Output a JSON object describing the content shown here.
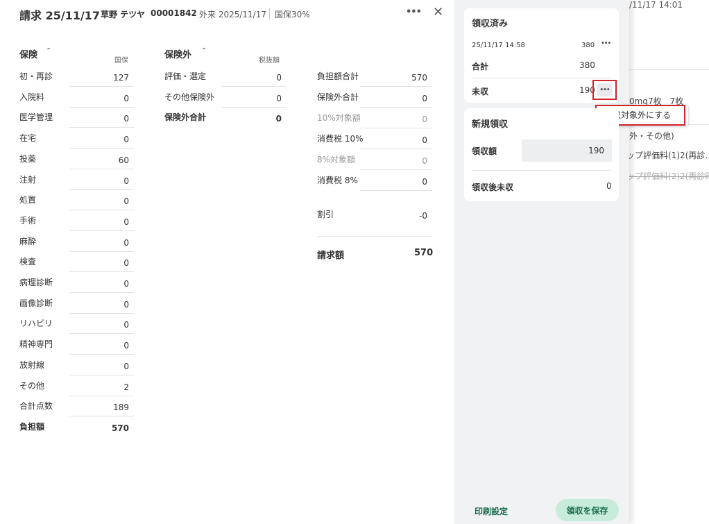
{
  "header": {
    "title": "請求 25/11/17",
    "patient_name": "草野 テツヤ",
    "patient_id": "00001842",
    "visit": "外来 2025/11/17",
    "insurance": "国保30%",
    "more_label": "•••",
    "close_label": "✕"
  },
  "insurance_section": {
    "title": "保険",
    "column_label": "国保",
    "rows": [
      {
        "label": "初・再診",
        "value": "127"
      },
      {
        "label": "入院料",
        "value": "0"
      },
      {
        "label": "医学管理",
        "value": "0"
      },
      {
        "label": "在宅",
        "value": "0"
      },
      {
        "label": "投薬",
        "value": "60"
      },
      {
        "label": "注射",
        "value": "0"
      },
      {
        "label": "処置",
        "value": "0"
      },
      {
        "label": "手術",
        "value": "0"
      },
      {
        "label": "麻酔",
        "value": "0"
      },
      {
        "label": "検査",
        "value": "0"
      },
      {
        "label": "病理診断",
        "value": "0"
      },
      {
        "label": "画像診断",
        "value": "0"
      },
      {
        "label": "リハビリ",
        "value": "0"
      },
      {
        "label": "精神専門",
        "value": "0"
      },
      {
        "label": "放射線",
        "value": "0"
      },
      {
        "label": "その他",
        "value": "2"
      },
      {
        "label": "合計点数",
        "value": "189"
      },
      {
        "label": "負担額",
        "value": "570"
      }
    ]
  },
  "non_insurance_section": {
    "title": "保険外",
    "column_label": "税抜額",
    "rows": [
      {
        "label": "評価・選定",
        "value": "0"
      },
      {
        "label": "その他保険外",
        "value": "0"
      },
      {
        "label": "保険外合計",
        "value": "0"
      }
    ]
  },
  "summary": {
    "rows": [
      {
        "label": "負担額合計",
        "value": "570"
      },
      {
        "label": "保険外合計",
        "value": "0"
      },
      {
        "label": "10%対象額",
        "value": "0"
      },
      {
        "label": "消費税 10%",
        "value": "0"
      },
      {
        "label": "8%対象額",
        "value": "0"
      },
      {
        "label": "消費税 8%",
        "value": "0"
      },
      {
        "label": "割引",
        "value": "-0"
      }
    ],
    "total_label": "請求額",
    "total_value": "570"
  },
  "received": {
    "title": "領収済み",
    "timestamp": "25/11/17 14:58",
    "amount": "380",
    "more_label": "•••",
    "total_label": "合計",
    "total_value": "380",
    "unpaid_label": "未収",
    "unpaid_value": "190",
    "unpaid_more_label": "•••"
  },
  "context_menu": {
    "item": "回収対象外にする"
  },
  "new_receipt": {
    "title": "新規領収",
    "amount_label": "領収額",
    "amount_value": "190",
    "after_label": "領収後未収",
    "after_value": "0"
  },
  "footer": {
    "print_settings": "印刷設定",
    "save_button": "領収を保存"
  },
  "background": {
    "timestamp": "/11/17 14:01",
    "line1": "0mg7枚　7枚",
    "line2": "外・その他)",
    "line3": "ップ評価料(1)2(再診…",
    "line4": "ップ評価料(2)2(再診時"
  },
  "colors": {
    "accent_green": "#1b6c4e",
    "save_bg": "#c8ecdc",
    "highlight_red": "#d3242a"
  }
}
